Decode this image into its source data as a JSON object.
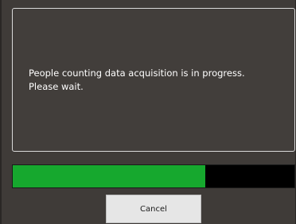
{
  "dialog": {
    "message_line1": "People counting data acquisition is in progress.",
    "message_line2": "Please wait.",
    "progress": {
      "fraction": 0.685,
      "fill_color": "#16a82e",
      "track_color": "#000000"
    },
    "cancel_label": "Cancel"
  }
}
